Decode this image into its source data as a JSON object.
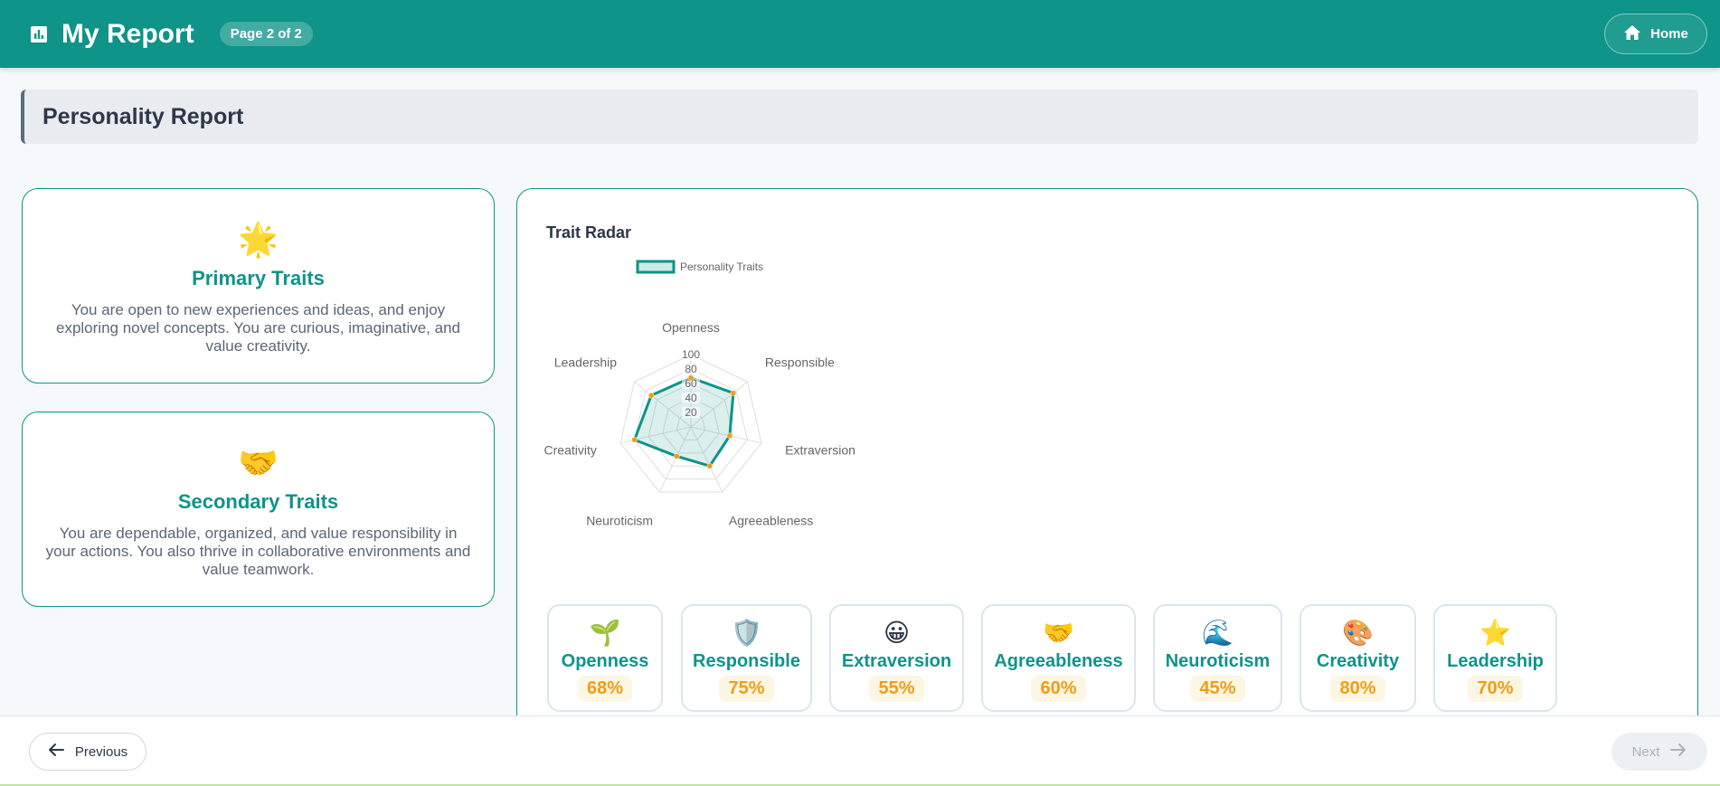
{
  "header": {
    "logo_icon": "bar-chart-icon",
    "title": "My Report",
    "page_badge": "Page 2 of 2",
    "home_label": "Home",
    "home_icon": "home-icon",
    "accent": "#0e9488"
  },
  "section": {
    "title": "Personality Report"
  },
  "primary": {
    "emoji": "🌟",
    "title": "Primary Traits",
    "text": "You are open to new experiences and ideas, and enjoy exploring novel concepts. You are curious, imaginative, and value creativity."
  },
  "secondary": {
    "emoji": "🤝",
    "title": "Secondary Traits",
    "text": "You are dependable, organized, and value responsibility in your actions. You also thrive in collaborative environments and value teamwork."
  },
  "radar": {
    "title": "Trait Radar"
  },
  "chart_data": {
    "type": "radar",
    "categories": [
      "Openness",
      "Responsible",
      "Extraversion",
      "Agreeableness",
      "Neuroticism",
      "Creativity",
      "Leadership"
    ],
    "series": [
      {
        "name": "Personality Traits",
        "values": [
          68,
          75,
          55,
          60,
          45,
          80,
          70
        ]
      }
    ],
    "rlim": [
      0,
      100
    ],
    "rticks": [
      "20",
      "40",
      "60",
      "80",
      "100"
    ],
    "legend": "top-left",
    "colors": {
      "line": "#0e9488",
      "fill": "#0e9488",
      "point": "#f39c12",
      "grid": "#dddddd"
    }
  },
  "metrics": [
    {
      "emoji": "🌱",
      "name": "Openness",
      "value": "68%"
    },
    {
      "emoji": "🛡️",
      "name": "Responsible",
      "value": "75%"
    },
    {
      "emoji": "😀",
      "name": "Extraversion",
      "value": "55%"
    },
    {
      "emoji": "🤝",
      "name": "Agreeableness",
      "value": "60%"
    },
    {
      "emoji": "🌊",
      "name": "Neuroticism",
      "value": "45%"
    },
    {
      "emoji": "🎨",
      "name": "Creativity",
      "value": "80%"
    },
    {
      "emoji": "⭐",
      "name": "Leadership",
      "value": "70%"
    }
  ],
  "footer": {
    "prev_label": "Previous",
    "prev_icon": "arrow-left-icon",
    "next_label": "Next",
    "next_icon": "arrow-right-icon"
  }
}
